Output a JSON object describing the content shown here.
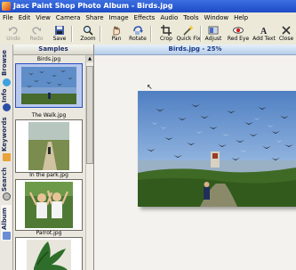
{
  "window": {
    "title": "Jasc Paint Shop Photo Album - Birds.jpg"
  },
  "menu": [
    "File",
    "Edit",
    "View",
    "Camera",
    "Share",
    "Image",
    "Effects",
    "Audio",
    "Tools",
    "Window",
    "Help"
  ],
  "toolbar": {
    "undo": "Undo",
    "redo": "Redo",
    "save": "Save",
    "zoom": "Zoom",
    "pan": "Pan",
    "rotate": "Rotate",
    "crop": "Crop",
    "quick_fix": "Quick Fix",
    "adjust": "Adjust",
    "red_eye": "Red Eye",
    "add_text": "Add Text",
    "close": "Close"
  },
  "vtabs": {
    "browse": "Browse",
    "info": "Info",
    "keywords": "Keywords",
    "search": "Search",
    "album": "Album"
  },
  "samples": {
    "header": "Samples",
    "items": [
      {
        "name": "Birds.jpg",
        "selected": true
      },
      {
        "name": "The Walk.jpg",
        "selected": false
      },
      {
        "name": "In the park.jpg",
        "selected": false
      },
      {
        "name": "Parrot.jpg",
        "selected": false
      }
    ]
  },
  "main": {
    "header": "Birds.jpg - 25%"
  },
  "colors": {
    "title_blue": "#1c4bc7",
    "selection": "#2a4dbf"
  }
}
